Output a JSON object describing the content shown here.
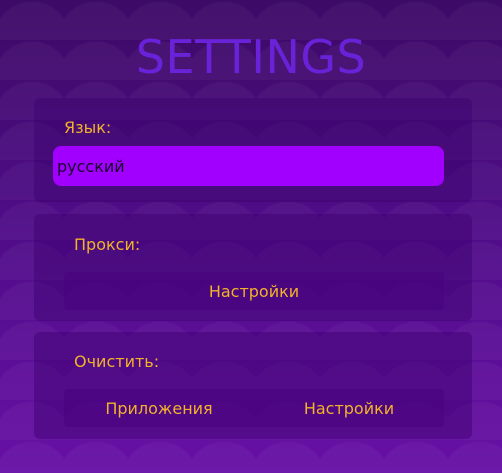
{
  "header": {
    "title": "SETTINGS"
  },
  "language": {
    "label": "Язык:",
    "selected": "русский"
  },
  "proxy": {
    "label": "Прокси:",
    "settings_button": "Настройки"
  },
  "clear": {
    "label": "Очистить:",
    "apps_button": "Приложения",
    "settings_button": "Настройки"
  },
  "colors": {
    "background_top": "#3d0a66",
    "background_bottom": "#6710a5",
    "title": "#6a22d8",
    "label": "#f2b22a",
    "select_bg": "#a100ff"
  }
}
